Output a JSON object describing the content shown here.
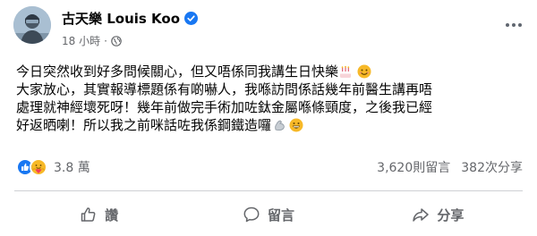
{
  "post": {
    "author": "古天樂 Louis Koo",
    "time": "18 小時",
    "separator": "·",
    "lines": [
      "今日突然收到好多問候關心，但又唔係同我講生日快樂",
      "大家放心，其實報導標題係有啲嚇人，我喺訪問係話幾年前醫生講再唔",
      "處理就神經壞死呀！幾年前做完手術加咗鈦金屬喺條頸度，之後我已經",
      "好返晒喇！所以我之前咪話咗我係鋼鐵造囉"
    ],
    "icons": {
      "avatar": "avatar",
      "verified": "verified-badge-icon",
      "audience": "globe-icon",
      "more": "more-options-icon",
      "line1_emojis": [
        "birthday-cake-emoji",
        "smiling-face-emoji"
      ],
      "line4_emojis": [
        "flexed-biceps-emoji",
        "grinning-face-emoji"
      ]
    }
  },
  "stats": {
    "reactions": [
      "like",
      "care"
    ],
    "reaction_count": "3.8 萬",
    "comments": "3,620則留言",
    "shares": "382次分享"
  },
  "actions": {
    "like": "讚",
    "comment": "留言",
    "share": "分享"
  },
  "colors": {
    "brand_blue": "#1877f2",
    "secondary_text": "#65676b",
    "primary_text": "#050505",
    "care_yellow": "#f7b928"
  }
}
